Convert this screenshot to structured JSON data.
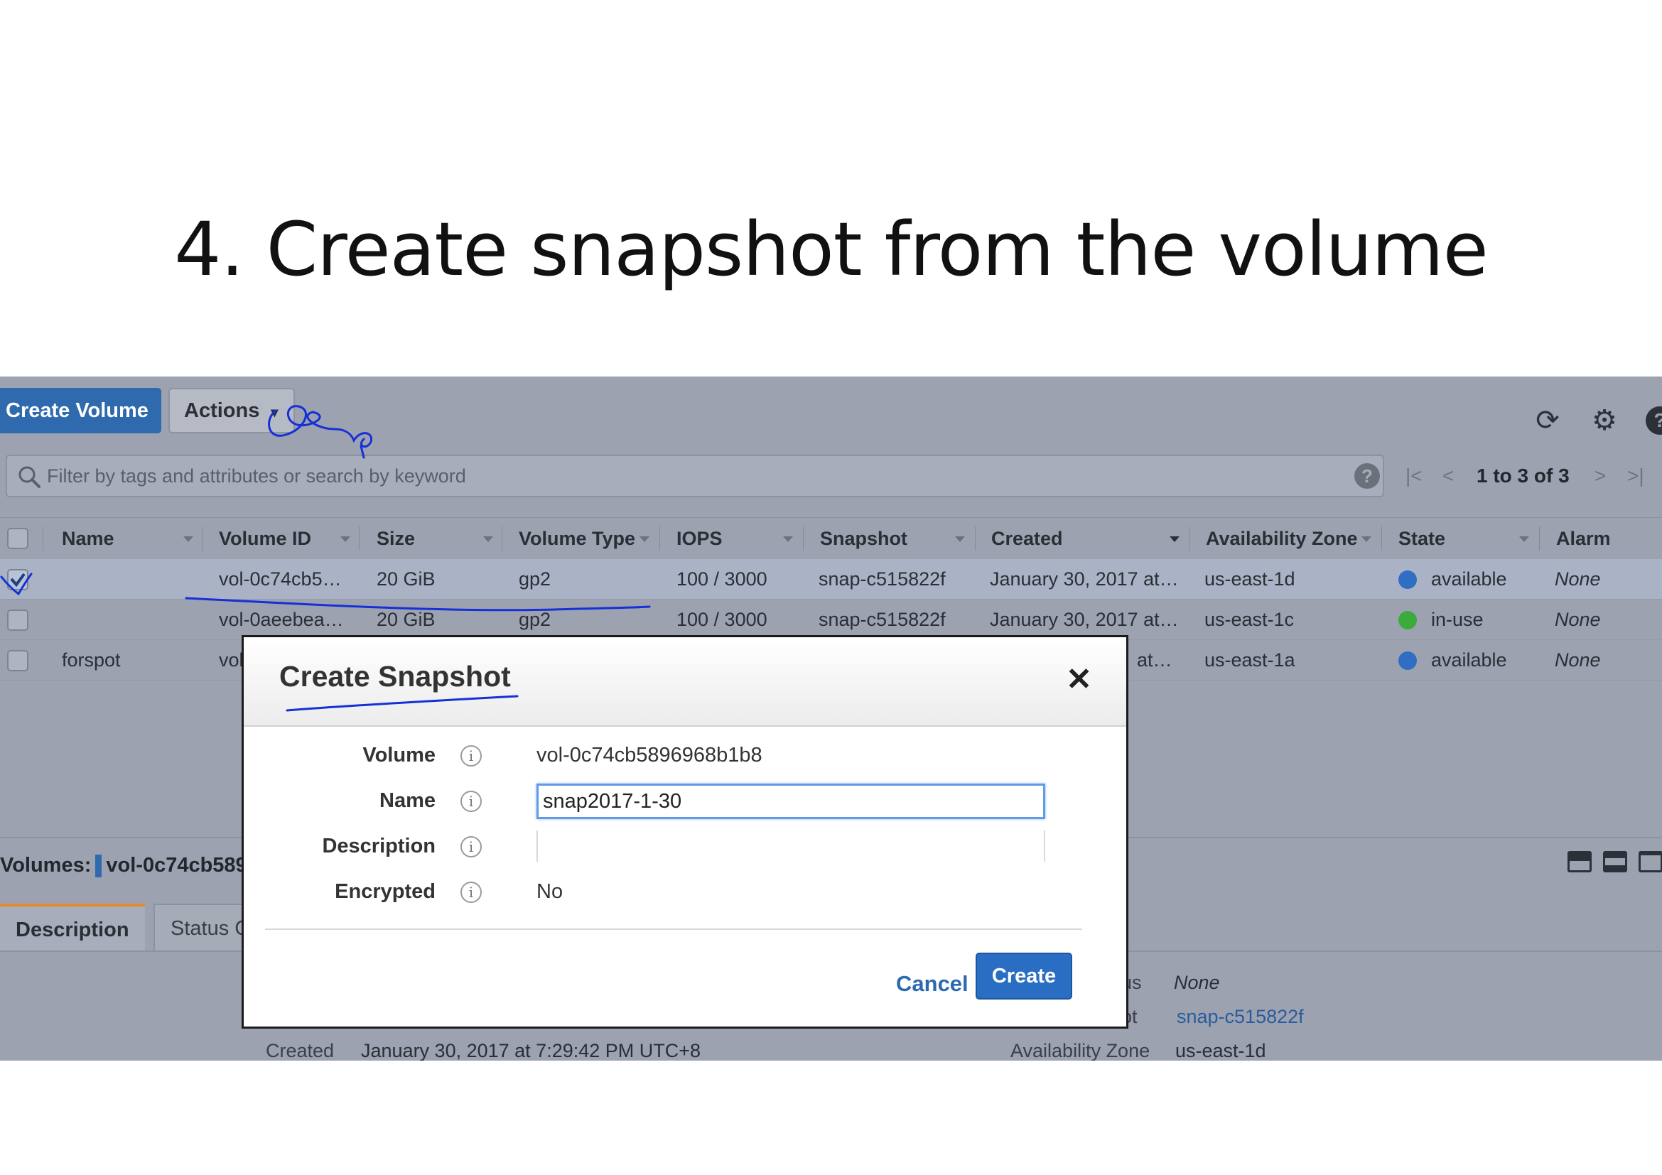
{
  "slide": {
    "title": "4. Create snapshot from the volume"
  },
  "toolbar": {
    "create_volume_label": "Create Volume",
    "actions_label": "Actions",
    "icons": [
      "refresh-icon",
      "gear-icon",
      "help-icon"
    ]
  },
  "search": {
    "placeholder": "Filter by tags and attributes or search by keyword",
    "help_glyph": "?"
  },
  "pager": {
    "first": "|<",
    "prev": "<",
    "text": "1 to 3 of 3",
    "next": ">",
    "last": ">|"
  },
  "table": {
    "columns": [
      "Name",
      "Volume ID",
      "Size",
      "Volume Type",
      "IOPS",
      "Snapshot",
      "Created",
      "Availability Zone",
      "State",
      "Alarm Statu"
    ],
    "rows": [
      {
        "name": "",
        "volume_id": "vol-0c74cb5…",
        "size": "20 GiB",
        "type": "gp2",
        "iops": "100 / 3000",
        "snapshot": "snap-c515822f",
        "created": "January 30, 2017 at…",
        "zone": "us-east-1d",
        "state": "available",
        "state_color": "#2f6ec3",
        "alarm": "None",
        "selected": true
      },
      {
        "name": "",
        "volume_id": "vol-0aeebea…",
        "size": "20 GiB",
        "type": "gp2",
        "iops": "100 / 3000",
        "snapshot": "snap-c515822f",
        "created": "January 30, 2017 at…",
        "zone": "us-east-1c",
        "state": "in-use",
        "state_color": "#3bab3b",
        "alarm": "None",
        "selected": false
      },
      {
        "name": "forspot",
        "volume_id": "vol",
        "size": "",
        "type": "",
        "iops": "",
        "snapshot": "",
        "created": "at…",
        "zone": "us-east-1a",
        "state": "available",
        "state_color": "#2f6ec3",
        "alarm": "None",
        "selected": false
      }
    ]
  },
  "details": {
    "volumes_label": "Volumes:",
    "volumes_value": "vol-0c74cb589",
    "tabs": [
      "Description",
      "Status C"
    ],
    "alarm_status_label_fragment": "us",
    "alarm_status_value": "None",
    "snapshot_label_fragment": "ot",
    "snapshot_value": "snap-c515822f",
    "created_label": "Created",
    "created_value": "January 30, 2017 at 7:29:42 PM UTC+8",
    "zone_label": "Availability Zone",
    "zone_value": "us-east-1d"
  },
  "modal": {
    "title": "Create Snapshot",
    "close_glyph": "✕",
    "fields": {
      "volume_label": "Volume",
      "volume_value": "vol-0c74cb5896968b1b8",
      "name_label": "Name",
      "name_value": "snap2017-1-30",
      "description_label": "Description",
      "description_value": "",
      "encrypted_label": "Encrypted",
      "encrypted_value": "No"
    },
    "info_glyph": "i",
    "cancel_label": "Cancel",
    "create_label": "Create"
  },
  "colors": {
    "primary_button": "#2f6aae",
    "modal_create": "#2a6ec3",
    "annotation_ink": "#1530d8",
    "available_dot": "#2f6ec3",
    "in_use_dot": "#3bab3b"
  }
}
